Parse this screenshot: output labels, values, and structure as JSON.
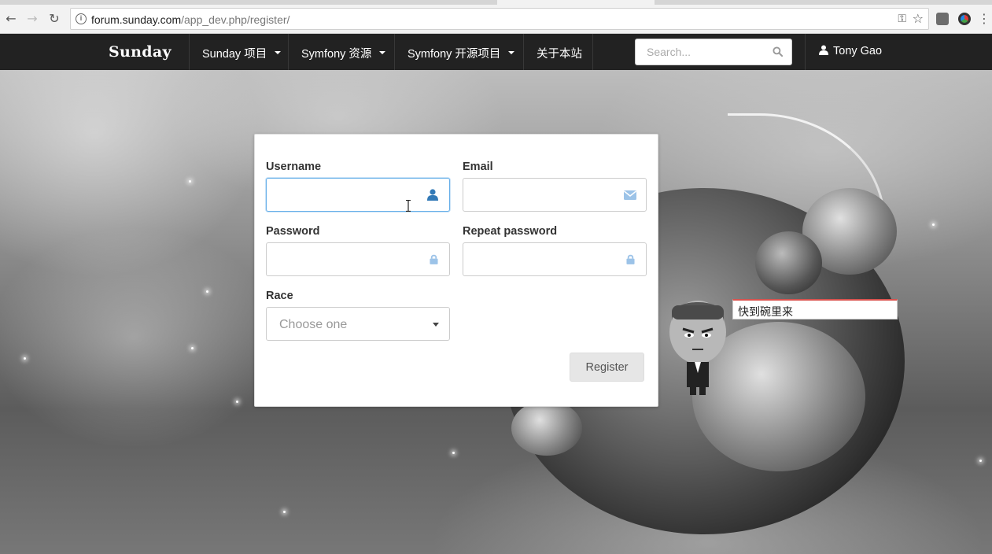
{
  "browser": {
    "url_host": "forum.sunday.com",
    "url_path": "/app_dev.php/register/"
  },
  "navbar": {
    "brand": "Sunday",
    "items": [
      {
        "label": "Sunday 项目",
        "dropdown": true
      },
      {
        "label": "Symfony 资源",
        "dropdown": true
      },
      {
        "label": "Symfony 开源项目",
        "dropdown": true
      },
      {
        "label": "关于本站",
        "dropdown": false
      }
    ],
    "search_placeholder": "Search...",
    "user": "Tony Gao"
  },
  "form": {
    "username_label": "Username",
    "email_label": "Email",
    "password_label": "Password",
    "repeat_password_label": "Repeat password",
    "race_label": "Race",
    "race_placeholder": "Choose one",
    "register_button": "Register"
  },
  "speech_bubble": "快到碗里来",
  "colors": {
    "navbar_bg": "#222222",
    "focus_border": "#66afe9",
    "icon_blue": "#337ab7",
    "icon_light_blue": "#9cc3e8",
    "speech_accent": "#d9534f"
  },
  "icons": [
    "back-icon",
    "forward-icon",
    "reload-icon",
    "info-icon",
    "key-icon",
    "star-icon",
    "search-icon",
    "user-icon",
    "envelope-icon",
    "lock-icon",
    "caret-down-icon"
  ]
}
